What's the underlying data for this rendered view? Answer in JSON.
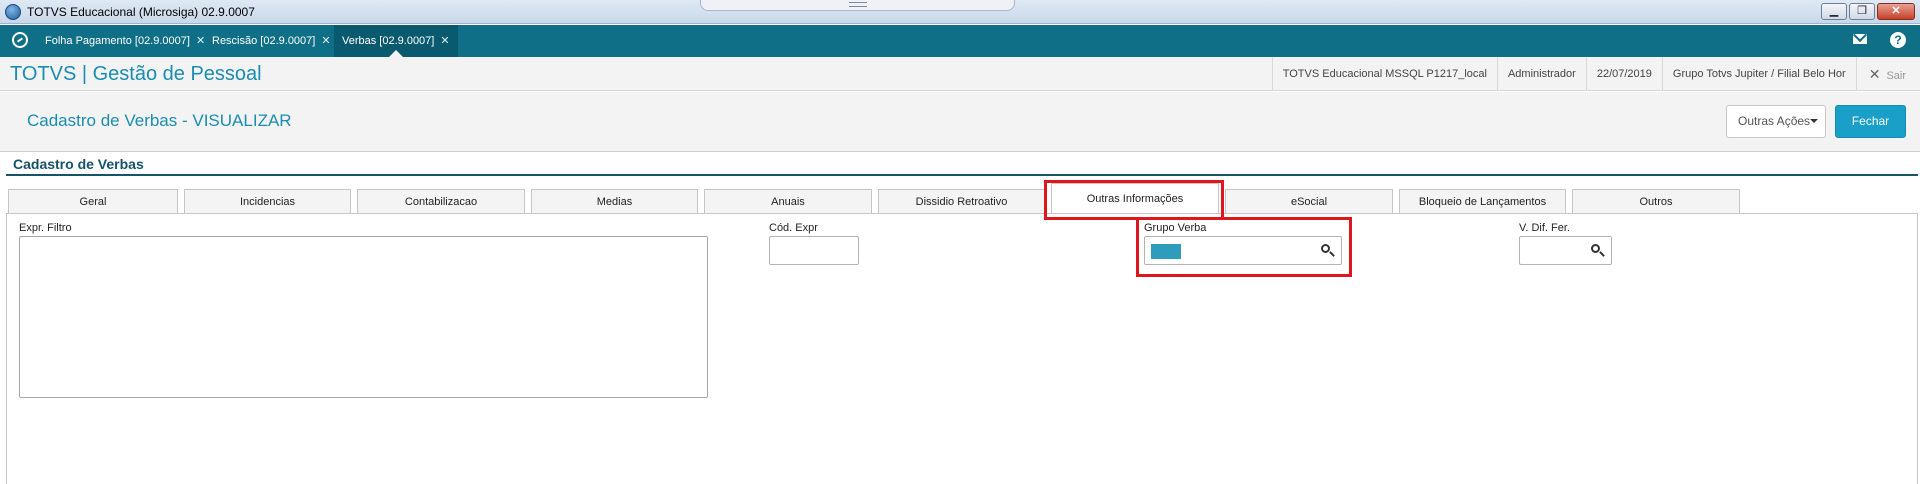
{
  "window": {
    "title": "TOTVS Educacional (Microsiga) 02.9.0007",
    "buttons": {
      "minimize": "▁",
      "maximize": "❐",
      "close": "✕"
    }
  },
  "app_tabs": [
    {
      "label": "Folha Pagamento [02.9.0007]",
      "close": "✕"
    },
    {
      "label": "Rescisão [02.9.0007]",
      "close": "✕"
    },
    {
      "label": "Verbas [02.9.0007]",
      "close": "✕"
    }
  ],
  "header": {
    "brand": "TOTVS | Gestão de Pessoal",
    "info": [
      "TOTVS Educacional MSSQL P1217_local",
      "Administrador",
      "22/07/2019",
      "Grupo Totvs Jupiter / Filial Belo Hor"
    ],
    "logout": "Sair",
    "logout_icon": "✕",
    "help": "?"
  },
  "page": {
    "title": "Cadastro de Verbas - VISUALIZAR",
    "other_actions": "Outras Ações",
    "close": "Fechar"
  },
  "form": {
    "section_title": "Cadastro de Verbas",
    "tabs": [
      "Geral",
      "Incidencias",
      "Contabilizacao",
      "Medias",
      "Anuais",
      "Dissidio Retroativo",
      "Outras Informações",
      "eSocial",
      "Bloqueio de Lançamentos",
      "Outros"
    ],
    "active_tab": "Outras Informações",
    "fields": {
      "expr_filtro": {
        "label": "Expr. Filtro",
        "value": ""
      },
      "cod_expr": {
        "label": "Cód. Expr",
        "value": ""
      },
      "grupo_verba": {
        "label": "Grupo Verba",
        "value": ""
      },
      "v_dif_fer": {
        "label": "V. Dif. Fer.",
        "value": ""
      }
    }
  },
  "colors": {
    "tab_bar": "#0e6f86",
    "brand": "#1a8db0",
    "primary_button": "#1aa0c8",
    "section_title": "#16536b",
    "highlight": "#e0161e"
  }
}
